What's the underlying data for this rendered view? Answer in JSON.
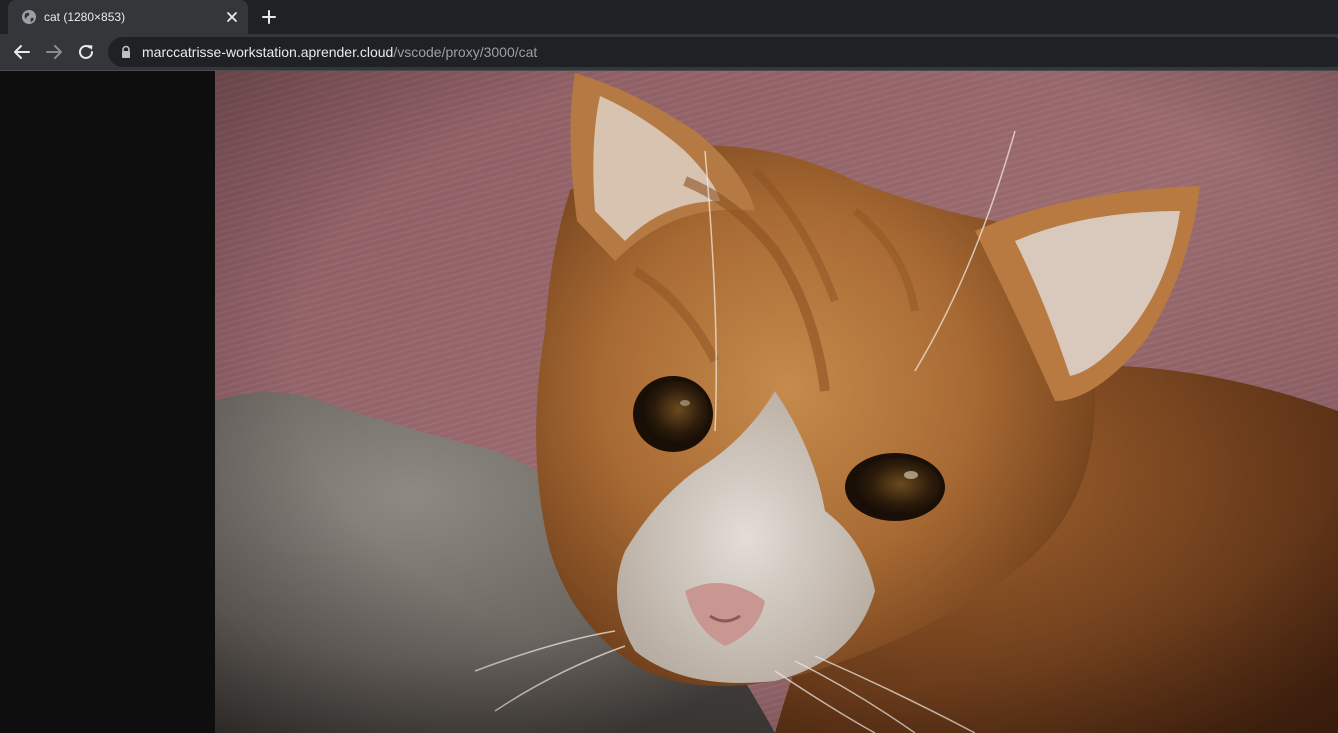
{
  "tab": {
    "title": "cat (1280×853)",
    "favicon_icon": "globe-icon",
    "close_icon": "close-icon"
  },
  "new_tab_icon": "plus-icon",
  "toolbar": {
    "back_icon": "back-arrow-icon",
    "forward_icon": "forward-arrow-icon",
    "reload_icon": "reload-icon"
  },
  "address_bar": {
    "lock_icon": "lock-icon",
    "host": "marccatrisse-workstation.aprender.cloud",
    "path": "/vscode/proxy/3000/cat"
  },
  "content": {
    "image_subject": "orange tabby cat photo"
  },
  "colors": {
    "tabstrip": "#202124",
    "toolbar": "#35363a",
    "omnibox": "#202124",
    "page_background": "#0e0e0e"
  }
}
